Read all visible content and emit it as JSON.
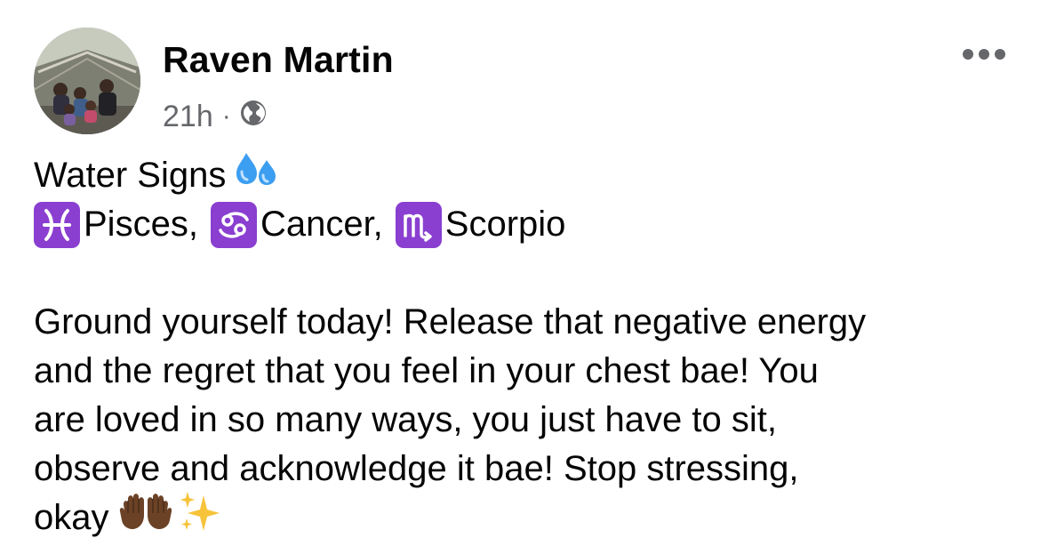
{
  "post": {
    "author": "Raven Martin",
    "time": "21h",
    "separator": "·",
    "audience_icon": "globe-icon",
    "menu_icon": "more-options-icon",
    "heading": "Water Signs",
    "heading_emoji": "sweat-droplets-icon",
    "signs": [
      {
        "icon": "pisces-icon",
        "label": "Pisces,"
      },
      {
        "icon": "cancer-icon",
        "label": "Cancer,"
      },
      {
        "icon": "scorpio-icon",
        "label": "Scorpio"
      }
    ],
    "body_lines": [
      "Ground yourself today! Release that negative energy",
      "and the regret that you feel in your chest bae! You",
      "are loved in so many ways, you just have to sit,",
      "observe and acknowledge it bae! Stop stressing,",
      "okay"
    ],
    "end_emojis": [
      "raised-hands-icon",
      "sparkles-icon"
    ],
    "colors": {
      "text": "#050505",
      "meta": "#65676b",
      "sign_badge": "#8a3fd0",
      "droplet": "#3c9ef0"
    }
  }
}
